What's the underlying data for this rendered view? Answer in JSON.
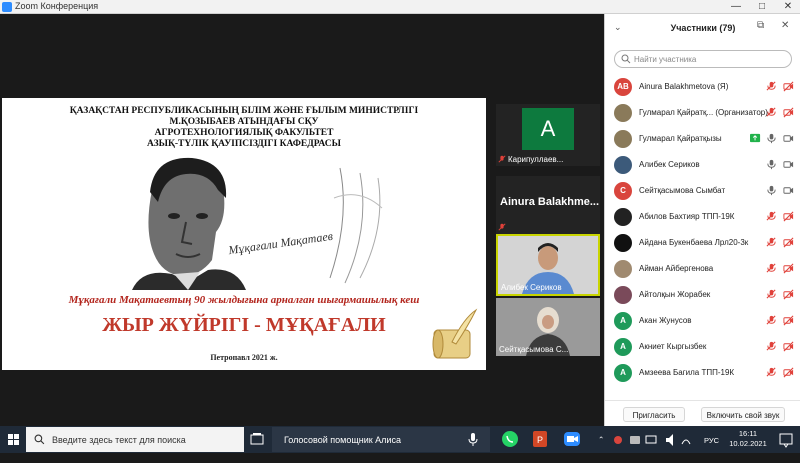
{
  "window": {
    "title": "Zoom Конференция",
    "controls": [
      "—",
      "□",
      "✕"
    ]
  },
  "slide": {
    "header_lines": [
      "ҚАЗАҚСТАН РЕСПУБЛИКАСЫНЫҢ БІЛІМ ЖӘНЕ ҒЫЛЫМ МИНИСТРЛІГІ",
      "М.ҚОЗЫБАЕВ АТЫНДАҒЫ СҚУ",
      "АГРОТЕХНОЛОГИЯЛЫҚ ФАКУЛЬТЕТ",
      "АЗЫҚ-ТҮЛІК ҚАУІПСІЗДІГІ КАФЕДРАСЫ"
    ],
    "signature": "Мұқағали Мақатаев",
    "subtitle": "Мұқағали Мақатаевтың 90 жылдығына арналған шығармашылық кеш",
    "main_title": "ЖЫР ЖҮЙРІГІ - МҰҚАҒАЛИ",
    "footer": "Петропавл 2021 ж."
  },
  "tiles": [
    {
      "name": "Карипуллаев...",
      "avatar_letter": "A",
      "muted": true
    },
    {
      "name": "Ainura Balakhme...",
      "muted": true
    },
    {
      "name": "Алибек Сериков",
      "muted": false
    },
    {
      "name": "Сейтқасымова С...",
      "muted": false
    }
  ],
  "participants_panel": {
    "title": "Участники (79)",
    "search_placeholder": "Найти участника",
    "participants": [
      {
        "initials": "AB",
        "name": "Ainura Balakhmetova (Я)",
        "color": "#d9453d",
        "mic": "muted",
        "video": "off"
      },
      {
        "initials": "",
        "name": "Гулмарал Қайратқ... (Организатор)",
        "color": "#8a7a5a",
        "mic": "muted",
        "video": "off"
      },
      {
        "initials": "",
        "name": "Гулмарал Қайратқызы",
        "color": "#8a7a5a",
        "mic": "on",
        "video": "on",
        "screen_share": true
      },
      {
        "initials": "",
        "name": "Алибек Сериков",
        "color": "#3c5a7a",
        "mic": "on",
        "video": "on"
      },
      {
        "initials": "С",
        "name": "Сейтқасымова Сымбат",
        "color": "#d9453d",
        "mic": "on",
        "video": "on"
      },
      {
        "initials": "",
        "name": "Абилов Бахтияр ТПП-19К",
        "color": "#222222",
        "mic": "muted",
        "video": "off"
      },
      {
        "initials": "",
        "name": "Айдана Букенбаева Лрл20-3к",
        "color": "#111111",
        "mic": "muted",
        "video": "off"
      },
      {
        "initials": "",
        "name": "Айман Айбергенова",
        "color": "#a08a70",
        "mic": "muted",
        "video": "off"
      },
      {
        "initials": "",
        "name": "Айтолқын Жорабек",
        "color": "#7a4a5a",
        "mic": "muted",
        "video": "off"
      },
      {
        "initials": "A",
        "name": "Акан Жунусов",
        "color": "#1f9a5a",
        "mic": "muted",
        "video": "off"
      },
      {
        "initials": "A",
        "name": "Акниет Кыргызбек",
        "color": "#1f9a5a",
        "mic": "muted",
        "video": "off"
      },
      {
        "initials": "A",
        "name": "Амзеева Багила ТПП-19К",
        "color": "#1f9a5a",
        "mic": "muted",
        "video": "off"
      }
    ],
    "invite_label": "Пригласить",
    "unmute_label": "Включить свой звук"
  },
  "taskbar": {
    "search_placeholder": "Введите здесь текст для поиска",
    "voice_assistant": "Голосовой помощник Алиса",
    "language": "РУС",
    "time": "16:11",
    "date": "10.02.2021"
  },
  "colors": {
    "zoom_blue": "#2d8cff",
    "muted_red": "#e0413a",
    "active_speaker": "#c8d400",
    "title_red": "#c0392b"
  }
}
